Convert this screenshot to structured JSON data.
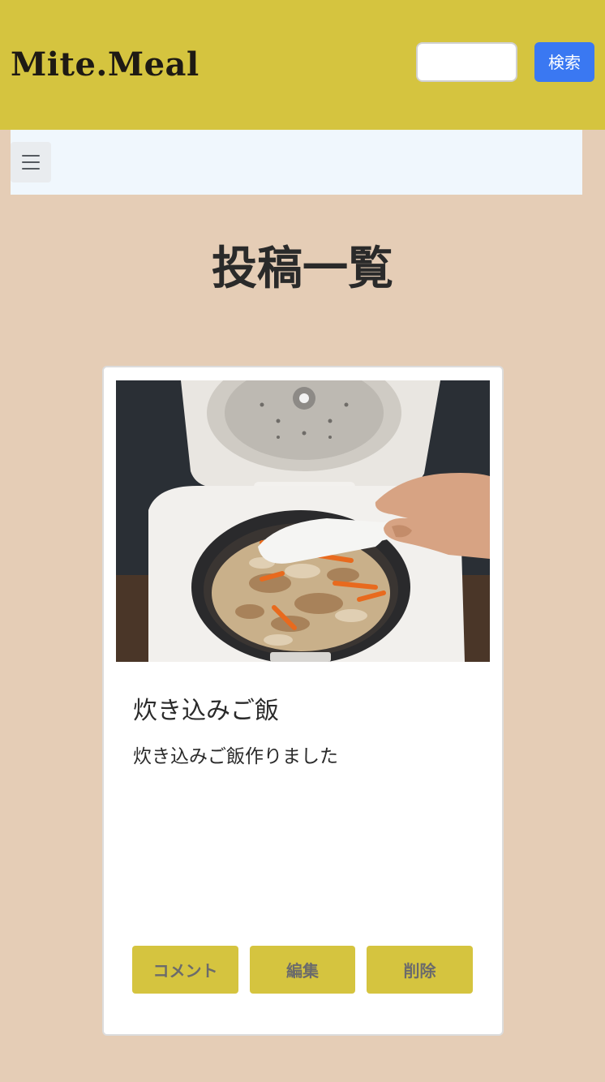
{
  "header": {
    "logo": "Mite.Meal",
    "search_placeholder": "",
    "search_button": "検索"
  },
  "nav": {
    "menu_icon": "hamburger-icon"
  },
  "main": {
    "title": "投稿一覧"
  },
  "post": {
    "image_subject": "rice-cooker-takikomi-gohan-photo",
    "title": "炊き込みご飯",
    "body": "炊き込みご飯作りました",
    "buttons": {
      "comment": "コメント",
      "edit": "編集",
      "delete": "削除"
    }
  },
  "colors": {
    "header_bg": "#d5c43f",
    "page_bg": "#e5cdb6",
    "nav_bg": "#f0f7fd",
    "search_button_bg": "#3a78f2",
    "action_button_bg": "#d5c43f"
  }
}
